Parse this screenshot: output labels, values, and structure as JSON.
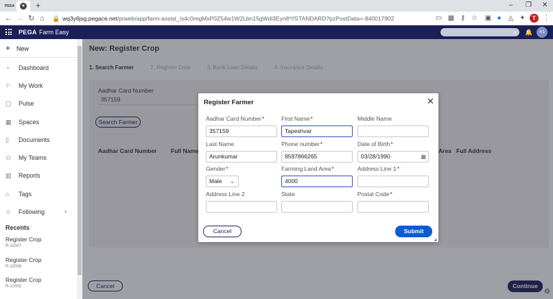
{
  "browser": {
    "tab1_icon": "PEGA",
    "url_host": "wq3y6jsg.pegace.net",
    "url_path": "/prweb/app/farm-assist_/s4c0regMxP0Z54w1W2Lbn15gWdi3Eyn8*/!STANDARD?pzPostData=-840017902",
    "profile_initial": "T"
  },
  "header": {
    "brand": "PEGA",
    "app_name": "Farm Easy",
    "user_initials": "A1"
  },
  "sidebar": {
    "new_label": "New",
    "items": [
      {
        "label": "Dashboard",
        "icon": "dashboard-icon"
      },
      {
        "label": "My Work",
        "icon": "flag-icon"
      },
      {
        "label": "Pulse",
        "icon": "pulse-icon"
      },
      {
        "label": "Spaces",
        "icon": "spaces-icon"
      },
      {
        "label": "Documents",
        "icon": "document-icon"
      },
      {
        "label": "My Teams",
        "icon": "teams-icon"
      },
      {
        "label": "Reports",
        "icon": "reports-icon"
      },
      {
        "label": "Tags",
        "icon": "tag-icon"
      },
      {
        "label": "Following",
        "icon": "star-icon"
      }
    ],
    "recent_heading": "Recents",
    "recents": [
      {
        "title": "Register Crop",
        "id": "R-12007"
      },
      {
        "title": "Register Crop",
        "id": "R-12006"
      },
      {
        "title": "Register Crop",
        "id": "R-12003"
      }
    ]
  },
  "main": {
    "title": "New:  Register Crop",
    "steps": [
      "1. Search Farmer",
      "2. Register Crop",
      "3. Bank Loan Details",
      "4. Insurance Details"
    ],
    "aadhar_label": "Aadhar Card Number",
    "aadhar_value": "357159",
    "search_button": "Search Farmer",
    "table_headers": [
      "Aadhar Card Number",
      "Full Name",
      "Area",
      "Full Address"
    ],
    "cancel_label": "Cancel",
    "continue_label": "Continue"
  },
  "modal": {
    "title": "Register Farmer",
    "fields": {
      "aadhar": {
        "label": "Aadhar Card Number",
        "value": "357159",
        "required": "*"
      },
      "first_name": {
        "label": "First Name",
        "value": "Tapeshvar",
        "required": "*"
      },
      "middle_name": {
        "label": "Middle Name",
        "value": ""
      },
      "last_name": {
        "label": "Last Name",
        "value": "Arunkumar"
      },
      "phone": {
        "label": "Phone number",
        "value": "9597866265",
        "required": "*"
      },
      "dob": {
        "label": "Date of Birth",
        "value": "03/28/1990",
        "required": "*"
      },
      "gender": {
        "label": "Gender",
        "value": "Male",
        "required": "*"
      },
      "land_area": {
        "label": "Farming Land Area",
        "value": "4000",
        "required": "*"
      },
      "address1": {
        "label": "Address Line 1",
        "value": "",
        "required": "*"
      },
      "address2": {
        "label": "Address Line 2",
        "value": ""
      },
      "state": {
        "label": "State",
        "value": ""
      },
      "postal": {
        "label": "Postal Code",
        "value": "",
        "required": "*"
      }
    },
    "cancel_label": "Cancel",
    "submit_label": "Submit"
  },
  "colors": {
    "header_bg": "#1a1f57",
    "submit_bg": "#0b5bd3",
    "required": "#cc0000"
  }
}
